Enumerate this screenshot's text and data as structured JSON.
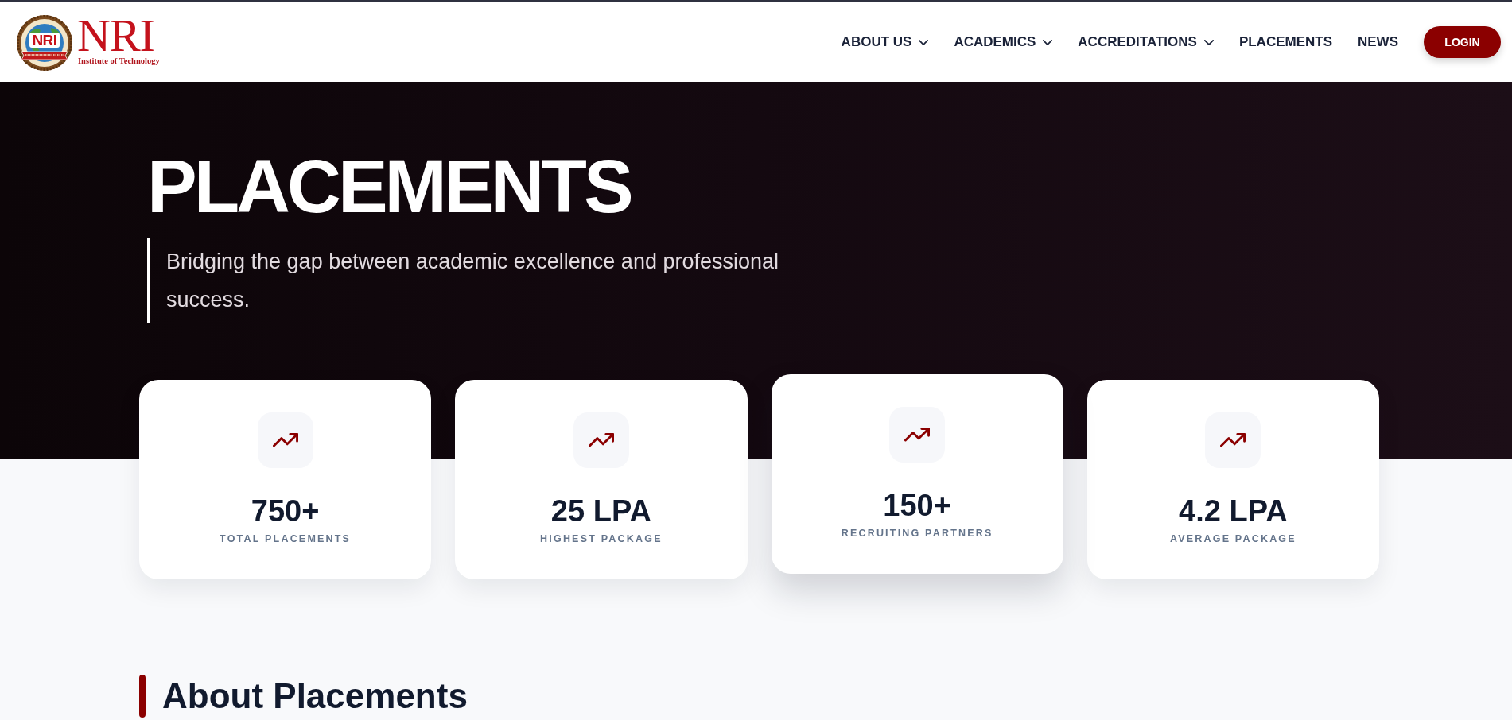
{
  "header": {
    "logo": {
      "emblem_text": "NRI",
      "name": "NRI",
      "subtitle": "Institute of Technology"
    },
    "nav": [
      {
        "label": "ABOUT US",
        "has_dropdown": true
      },
      {
        "label": "ACADEMICS",
        "has_dropdown": true
      },
      {
        "label": "ACCREDITATIONS",
        "has_dropdown": true
      },
      {
        "label": "PLACEMENTS",
        "has_dropdown": false
      },
      {
        "label": "NEWS",
        "has_dropdown": false
      }
    ],
    "login_button": "LOGIN"
  },
  "hero": {
    "title": "PLACEMENTS",
    "subtitle": "Bridging the gap between academic excellence and professional success."
  },
  "stats": [
    {
      "value": "750+",
      "label": "TOTAL PLACEMENTS",
      "hovered": false
    },
    {
      "value": "25 LPA",
      "label": "HIGHEST PACKAGE",
      "hovered": false
    },
    {
      "value": "150+",
      "label": "RECRUITING PARTNERS",
      "hovered": true
    },
    {
      "value": "4.2 LPA",
      "label": "AVERAGE PACKAGE",
      "hovered": false
    }
  ],
  "about": {
    "heading": "About Placements"
  }
}
